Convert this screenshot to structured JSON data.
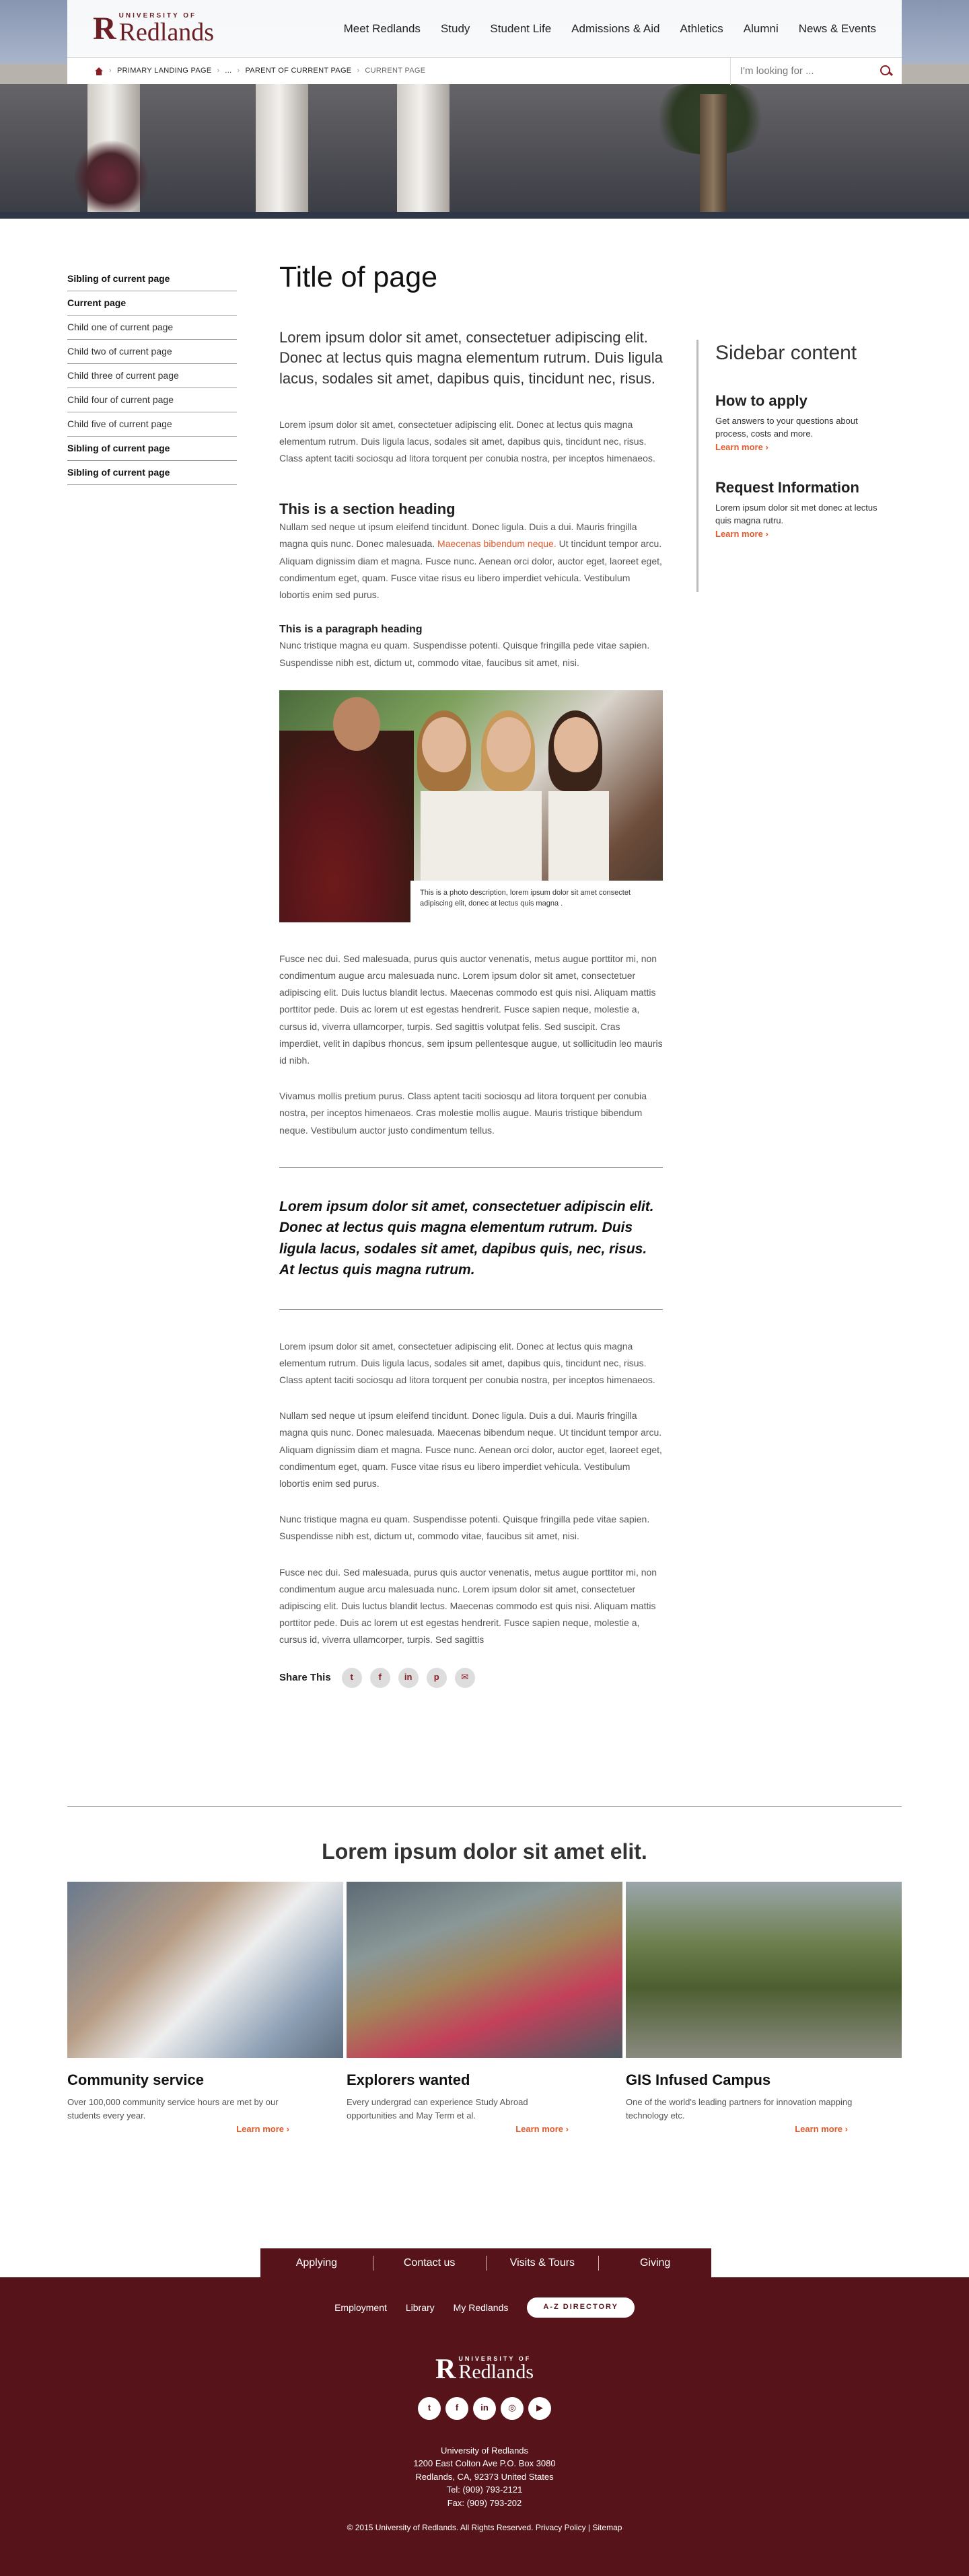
{
  "header": {
    "logo_university": "UNIVERSITY OF",
    "logo_name": "Redlands",
    "nav": [
      "Meet Redlands",
      "Study",
      "Student Life",
      "Admissions & Aid",
      "Athletics",
      "Alumni",
      "News & Events"
    ],
    "breadcrumb": [
      "PRIMARY LANDING PAGE",
      "...",
      "PARENT OF CURRENT PAGE",
      "CURRENT PAGE"
    ],
    "search_placeholder": "I'm looking for ..."
  },
  "leftnav": [
    {
      "label": "Sibling of current page",
      "bold": true
    },
    {
      "label": "Current page",
      "bold": true
    },
    {
      "label": "Child one of current page",
      "bold": false
    },
    {
      "label": "Child two of current page",
      "bold": false
    },
    {
      "label": "Child three of current page",
      "bold": false
    },
    {
      "label": "Child four of current page",
      "bold": false
    },
    {
      "label": "Child five of current page",
      "bold": false
    },
    {
      "label": "Sibling of current page",
      "bold": true
    },
    {
      "label": "Sibling of current page",
      "bold": true
    }
  ],
  "content": {
    "title": "Title of page",
    "lead": "Lorem ipsum dolor sit amet, consectetuer adipiscing elit. Donec at lectus quis magna elementum rutrum. Duis ligula lacus, sodales sit amet, dapibus quis, tincidunt nec, risus.",
    "p1": "Lorem ipsum dolor sit amet, consectetuer adipiscing elit. Donec at lectus quis magna elementum rutrum. Duis ligula lacus, sodales sit amet, dapibus quis, tincidunt nec, risus. Class aptent taciti sociosqu ad litora torquent per conubia nostra, per inceptos himenaeos.",
    "section_heading": "This is a section heading",
    "p2_before": "Nullam sed neque ut ipsum eleifend tincidunt. Donec ligula. Duis a dui. Mauris fringilla magna quis nunc. Donec malesuada. ",
    "p2_link": "Maecenas bibendum neque.",
    "p2_after": " Ut tincidunt tempor arcu. Aliquam dignissim diam et magna. Fusce nunc. Aenean orci dolor, auctor eget, laoreet eget, condimentum eget, quam. Fusce vitae risus eu libero imperdiet vehicula. Vestibulum lobortis enim sed purus.",
    "paragraph_heading": "This is a paragraph heading",
    "p3": "Nunc tristique magna eu quam. Suspendisse potenti. Quisque fringilla pede vitae sapien. Suspendisse nibh est, dictum ut, commodo vitae, faucibus sit amet, nisi.",
    "photo_caption": "This is a photo description, lorem ipsum dolor sit amet consectet adipiscing elit, donec at lectus quis magna .",
    "p4": "Fusce nec dui. Sed malesuada, purus quis auctor venenatis, metus augue porttitor mi, non condimentum augue arcu malesuada nunc. Lorem ipsum dolor sit amet, consectetuer adipiscing elit. Duis luctus blandit lectus. Maecenas commodo est quis nisi. Aliquam mattis porttitor pede. Duis ac lorem ut est egestas hendrerit. Fusce sapien neque, molestie a, cursus id, viverra ullamcorper, turpis. Sed sagittis volutpat felis. Sed suscipit. Cras imperdiet, velit in dapibus rhoncus, sem ipsum pellentesque augue, ut sollicitudin leo mauris id nibh.",
    "p5": "Vivamus mollis pretium purus. Class aptent taciti sociosqu ad litora torquent per conubia nostra, per inceptos himenaeos. Cras molestie mollis augue. Mauris tristique bibendum neque. Vestibulum auctor justo condimentum tellus.",
    "pullquote": "Lorem ipsum dolor sit amet, consectetuer adipiscin elit. Donec at lectus quis magna elementum rutrum. Duis ligula lacus, sodales sit amet, dapibus quis, nec, risus. At lectus quis magna rutrum.",
    "p6": "Lorem ipsum dolor sit amet, consectetuer adipiscing elit. Donec at lectus quis magna elementum rutrum. Duis ligula lacus, sodales sit amet, dapibus quis, tincidunt nec, risus. Class aptent taciti sociosqu ad litora torquent per conubia nostra, per inceptos himenaeos.",
    "p7": "Nullam sed neque ut ipsum eleifend tincidunt. Donec ligula. Duis a dui. Mauris fringilla magna quis nunc. Donec malesuada. Maecenas bibendum neque. Ut tincidunt tempor arcu. Aliquam dignissim diam et magna. Fusce nunc. Aenean orci dolor, auctor eget, laoreet eget, condimentum eget, quam. Fusce vitae risus eu libero imperdiet vehicula. Vestibulum lobortis enim sed purus.",
    "p8": "Nunc tristique magna eu quam. Suspendisse potenti. Quisque fringilla pede vitae sapien. Suspendisse nibh est, dictum ut, commodo vitae, faucibus sit amet, nisi.",
    "p9": "Fusce nec dui. Sed malesuada, purus quis auctor venenatis, metus augue porttitor mi, non condimentum augue arcu malesuada nunc. Lorem ipsum dolor sit amet, consectetuer adipiscing elit. Duis luctus blandit lectus. Maecenas commodo est quis nisi. Aliquam mattis porttitor pede. Duis ac lorem ut est egestas hendrerit. Fusce sapien neque, molestie a, cursus id, viverra ullamcorper, turpis. Sed sagittis",
    "share_label": "Share This",
    "share_icons": [
      "twitter-icon",
      "facebook-icon",
      "linkedin-icon",
      "pinterest-icon",
      "email-icon"
    ]
  },
  "sidebar": {
    "title": "Sidebar content",
    "blocks": [
      {
        "heading": "How to apply",
        "text": "Get answers to your questions about process, costs and more.",
        "link": "Learn more"
      },
      {
        "heading": "Request Information",
        "text": "Lorem ipsum dolor sit met donec at lectus quis magna rutru.",
        "link": "Learn more"
      }
    ]
  },
  "feature": {
    "title": "Lorem ipsum dolor sit amet elit.",
    "cards": [
      {
        "title": "Community service",
        "text": "Over 100,000 community service hours are met by our students every year.",
        "link": "Learn more"
      },
      {
        "title": "Explorers wanted",
        "text": "Every undergrad can experience Study Abroad opportunities and May Term et al.",
        "link": "Learn more"
      },
      {
        "title": "GIS Infused Campus",
        "text": "One of the world's leading partners for innovation mapping technology etc.",
        "link": "Learn more"
      }
    ]
  },
  "footer": {
    "tabs": [
      "Applying",
      "Contact us",
      "Visits & Tours",
      "Giving"
    ],
    "links": [
      "Employment",
      "Library",
      "My Redlands"
    ],
    "az_button": "A-Z DIRECTORY",
    "address": [
      "University of Redlands",
      "1200 East Colton Ave P.O. Box 3080",
      "Redlands, CA, 92373 United States",
      "Tel: (909) 793-2121",
      "Fax: (909) 793-202"
    ],
    "copyright": "© 2015 University of Redlands. All Rights Reserved.",
    "privacy": "Privacy Policy",
    "sitemap": "Sitemap"
  },
  "colors": {
    "brand": "#56141a",
    "accent": "#e05a2b"
  }
}
